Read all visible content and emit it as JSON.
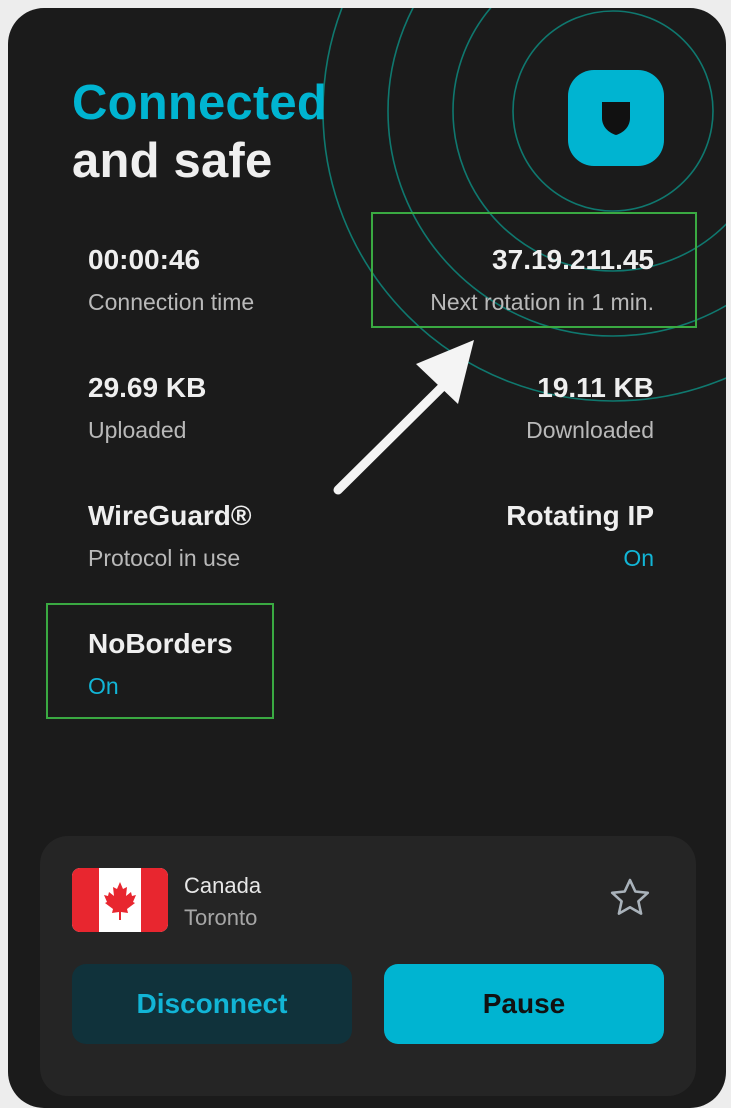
{
  "status": {
    "line1": "Connected",
    "line2": "and safe"
  },
  "icons": {
    "status_button": "shield-icon",
    "favorite": "star-outline-icon",
    "flag": "canada-flag-icon"
  },
  "colors": {
    "accent": "#00b4d1",
    "background": "#1b1b1b",
    "card": "#252525",
    "highlight_box": "#3aaa42"
  },
  "stats": {
    "connection_time": {
      "value": "00:00:46",
      "label": "Connection time"
    },
    "ip": {
      "value": "37.19.211.45",
      "label": "Next rotation in 1 min."
    },
    "uploaded": {
      "value": "29.69 KB",
      "label": "Uploaded"
    },
    "downloaded": {
      "value": "19.11 KB",
      "label": "Downloaded"
    },
    "protocol": {
      "value": "WireGuard®",
      "label": "Protocol in use"
    },
    "rotating_ip": {
      "value": "Rotating IP",
      "label": "On"
    },
    "noborders": {
      "value": "NoBorders",
      "label": "On"
    }
  },
  "location": {
    "country": "Canada",
    "city": "Toronto"
  },
  "actions": {
    "disconnect": "Disconnect",
    "pause": "Pause"
  }
}
